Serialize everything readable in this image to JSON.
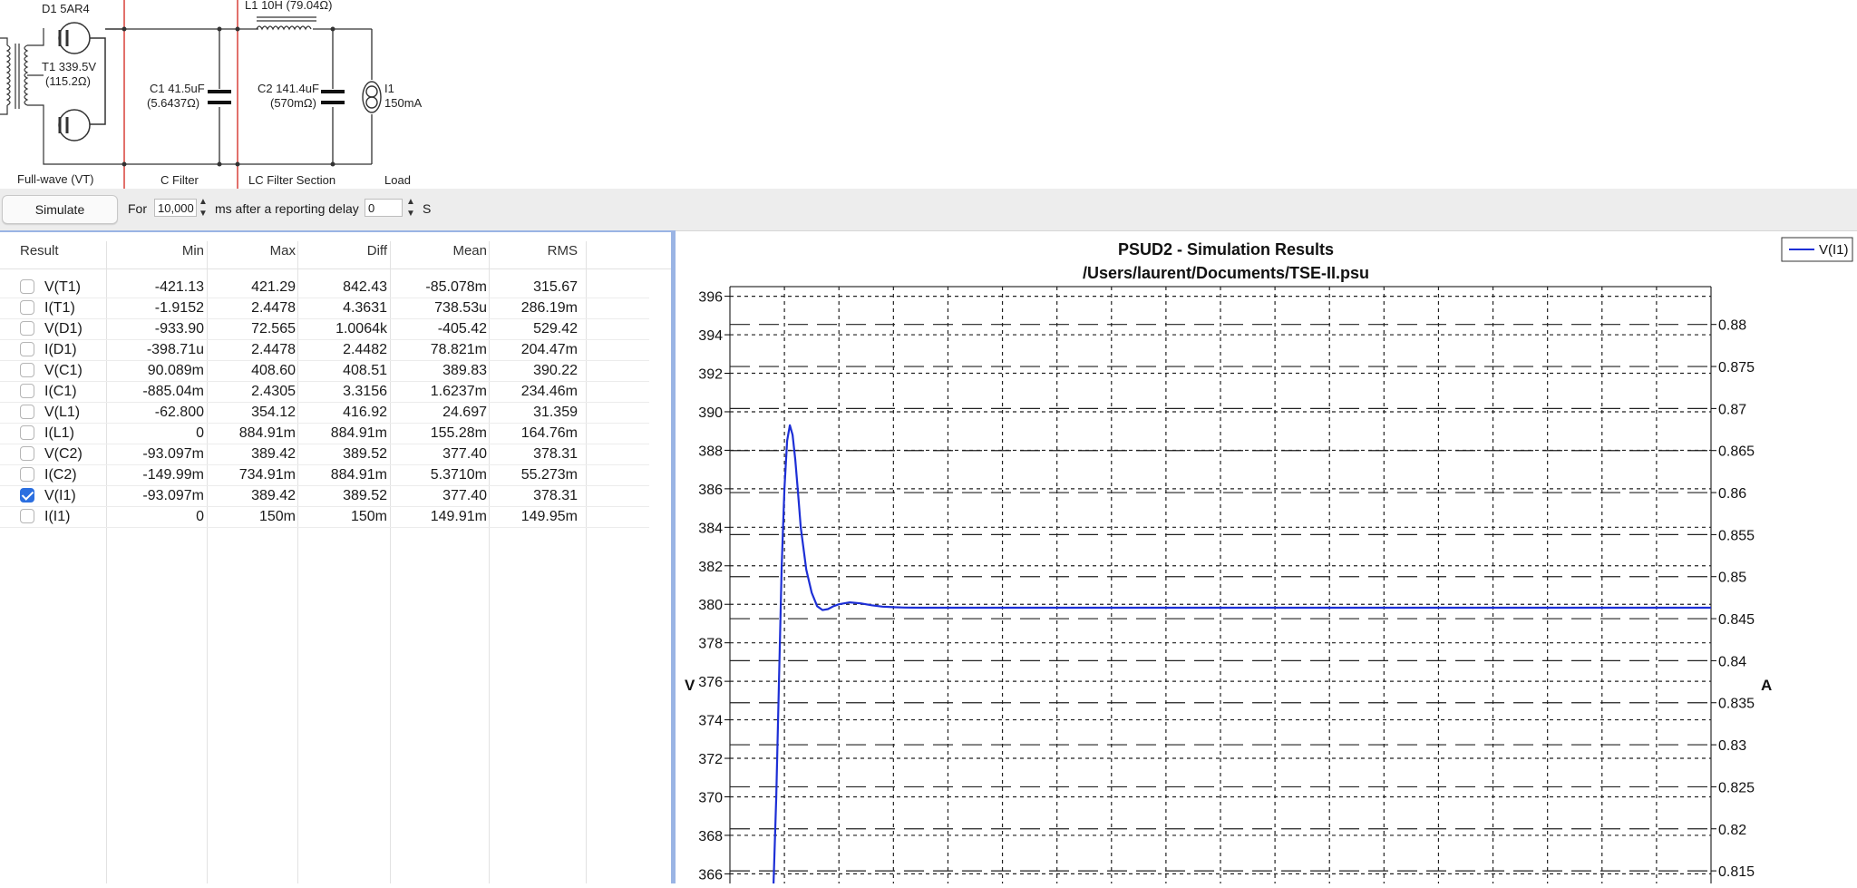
{
  "schematic": {
    "d1_label": "D1 5AR4",
    "l1_label": "L1 10H (79.04Ω)",
    "t1_label": "T1 339.5V",
    "t1_res": "(115.2Ω)",
    "c1_label": "C1 41.5uF",
    "c1_res": "(5.6437Ω)",
    "c2_label": "C2 141.4uF",
    "c2_res": "(570mΩ)",
    "i1_label": "I1",
    "i1_value": "150mA",
    "sections": [
      "Full-wave (VT)",
      "C Filter",
      "LC Filter Section",
      "Load"
    ]
  },
  "toolbar": {
    "simulate_label": "Simulate",
    "for_label": "For",
    "duration_value": "10,000",
    "after_label": "ms after a reporting delay",
    "delay_value": "0",
    "unit_label": "S"
  },
  "table": {
    "headers": [
      "Result",
      "Min",
      "Max",
      "Diff",
      "Mean",
      "RMS"
    ],
    "rows": [
      {
        "name": "V(T1)",
        "checked": false,
        "min": "-421.13",
        "max": "421.29",
        "diff": "842.43",
        "mean": "-85.078m",
        "rms": "315.67"
      },
      {
        "name": "I(T1)",
        "checked": false,
        "min": "-1.9152",
        "max": "2.4478",
        "diff": "4.3631",
        "mean": "738.53u",
        "rms": "286.19m"
      },
      {
        "name": "V(D1)",
        "checked": false,
        "min": "-933.90",
        "max": "72.565",
        "diff": "1.0064k",
        "mean": "-405.42",
        "rms": "529.42"
      },
      {
        "name": "I(D1)",
        "checked": false,
        "min": "-398.71u",
        "max": "2.4478",
        "diff": "2.4482",
        "mean": "78.821m",
        "rms": "204.47m"
      },
      {
        "name": "V(C1)",
        "checked": false,
        "min": "90.089m",
        "max": "408.60",
        "diff": "408.51",
        "mean": "389.83",
        "rms": "390.22"
      },
      {
        "name": "I(C1)",
        "checked": false,
        "min": "-885.04m",
        "max": "2.4305",
        "diff": "3.3156",
        "mean": "1.6237m",
        "rms": "234.46m"
      },
      {
        "name": "V(L1)",
        "checked": false,
        "min": "-62.800",
        "max": "354.12",
        "diff": "416.92",
        "mean": "24.697",
        "rms": "31.359"
      },
      {
        "name": "I(L1)",
        "checked": false,
        "min": "0",
        "max": "884.91m",
        "diff": "884.91m",
        "mean": "155.28m",
        "rms": "164.76m"
      },
      {
        "name": "V(C2)",
        "checked": false,
        "min": "-93.097m",
        "max": "389.42",
        "diff": "389.52",
        "mean": "377.40",
        "rms": "378.31"
      },
      {
        "name": "I(C2)",
        "checked": false,
        "min": "-149.99m",
        "max": "734.91m",
        "diff": "884.91m",
        "mean": "5.3710m",
        "rms": "55.273m"
      },
      {
        "name": "V(I1)",
        "checked": true,
        "min": "-93.097m",
        "max": "389.42",
        "diff": "389.52",
        "mean": "377.40",
        "rms": "378.31"
      },
      {
        "name": "I(I1)",
        "checked": false,
        "min": "0",
        "max": "150m",
        "diff": "150m",
        "mean": "149.91m",
        "rms": "149.95m"
      }
    ]
  },
  "chart": {
    "title": "PSUD2 - Simulation Results",
    "subtitle": "/Users/laurent/Documents/TSE-II.psu",
    "legend_label": "V(I1)",
    "series_color": "#1d2fd6"
  },
  "chart_data": {
    "type": "line",
    "title": "PSUD2 - Simulation Results",
    "subtitle": "/Users/laurent/Documents/TSE-II.psu",
    "ylabel": "V",
    "y2label": "A",
    "legend": "top-right",
    "grid": true,
    "ylim": [
      365.5,
      396.5
    ],
    "y_ticks": [
      396,
      394,
      392,
      390,
      388,
      386,
      384,
      382,
      380,
      378,
      376,
      374,
      372,
      370,
      368,
      366
    ],
    "y2_ticks": [
      "0.88",
      "0.875",
      "0.87",
      "0.865",
      "0.86",
      "0.855",
      "0.85",
      "0.845",
      "0.84",
      "0.835",
      "0.83",
      "0.825",
      "0.82",
      "0.815"
    ],
    "y2_values": [
      0.88,
      0.875,
      0.87,
      0.865,
      0.86,
      0.855,
      0.85,
      0.845,
      0.84,
      0.835,
      0.83,
      0.825,
      0.82,
      0.815
    ],
    "y2lim": [
      0.8135,
      0.8845
    ],
    "xlim": [
      0,
      18
    ],
    "series": [
      {
        "name": "V(I1)",
        "x": [
          0.8,
          0.85,
          0.9,
          0.95,
          1.0,
          1.05,
          1.1,
          1.15,
          1.2,
          1.25,
          1.3,
          1.4,
          1.5,
          1.6,
          1.7,
          1.8,
          1.9,
          2.0,
          2.2,
          2.4,
          2.6,
          2.8,
          3.0,
          3.2,
          3.5,
          4.0,
          6.0,
          10.0,
          14.0,
          18.0
        ],
        "values": [
          365.5,
          370.0,
          376.0,
          382.0,
          386.0,
          388.5,
          389.3,
          388.8,
          387.5,
          385.8,
          384.0,
          381.8,
          380.6,
          379.9,
          379.7,
          379.75,
          379.9,
          380.0,
          380.1,
          380.05,
          379.95,
          379.88,
          379.85,
          379.83,
          379.82,
          379.82,
          379.82,
          379.82,
          379.82,
          379.82
        ]
      }
    ]
  }
}
